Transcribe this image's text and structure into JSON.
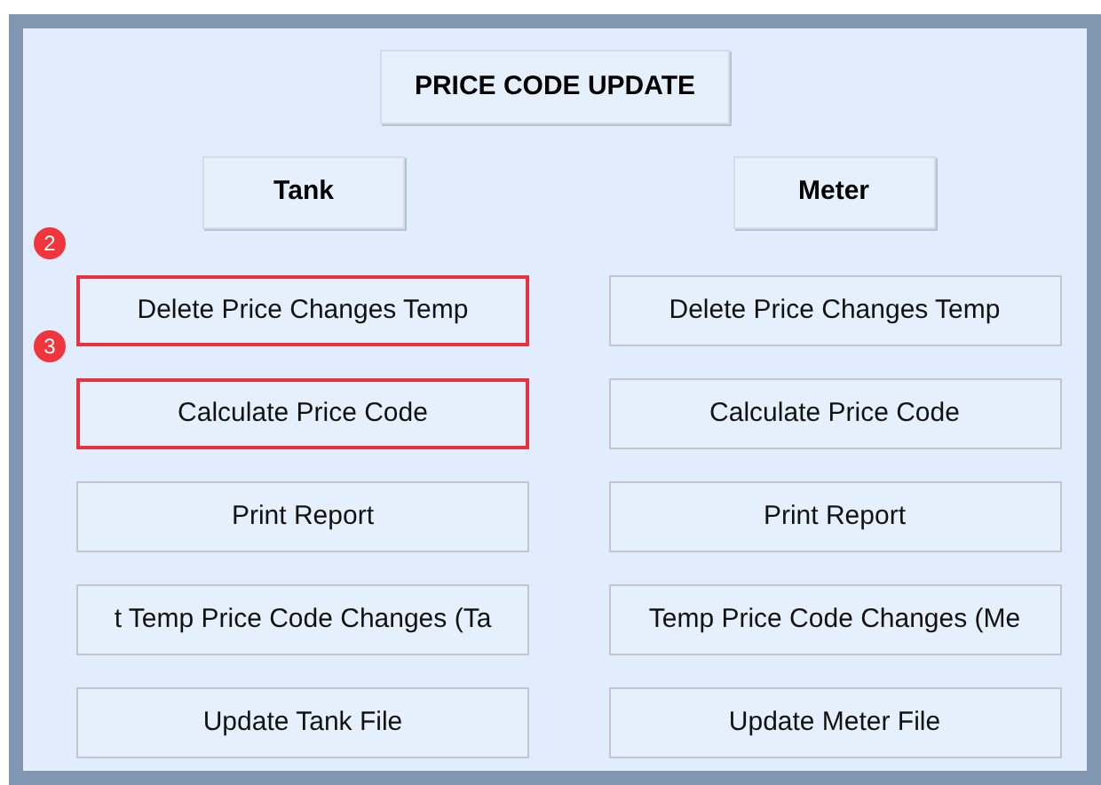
{
  "title": "PRICE CODE UPDATE",
  "columns": [
    {
      "header": "Tank",
      "buttons": [
        {
          "label": "Delete Price Changes Temp",
          "highlighted": true,
          "step": "2"
        },
        {
          "label": "Calculate Price Code",
          "highlighted": true,
          "step": "3"
        },
        {
          "label": "Print Report",
          "highlighted": false
        },
        {
          "label": "t Temp Price Code Changes (Ta",
          "highlighted": false
        },
        {
          "label": "Update Tank File",
          "highlighted": false
        }
      ]
    },
    {
      "header": "Meter",
      "buttons": [
        {
          "label": "Delete Price Changes Temp",
          "highlighted": false
        },
        {
          "label": "Calculate Price Code",
          "highlighted": false
        },
        {
          "label": "Print Report",
          "highlighted": false
        },
        {
          "label": "Temp Price Code Changes (Me",
          "highlighted": false
        },
        {
          "label": "Update Meter File",
          "highlighted": false
        }
      ]
    }
  ]
}
